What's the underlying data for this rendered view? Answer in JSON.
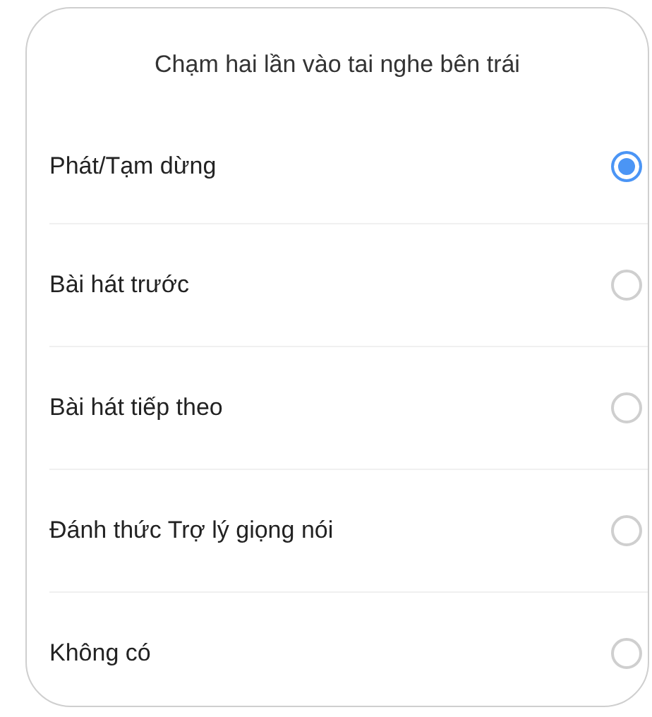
{
  "title": "Chạm hai lần vào tai nghe bên trái",
  "options": [
    {
      "label": "Phát/Tạm dừng",
      "selected": true
    },
    {
      "label": "Bài hát trước",
      "selected": false
    },
    {
      "label": "Bài hát tiếp theo",
      "selected": false
    },
    {
      "label": "Đánh thức Trợ lý giọng nói",
      "selected": false
    },
    {
      "label": "Không có",
      "selected": false
    }
  ]
}
